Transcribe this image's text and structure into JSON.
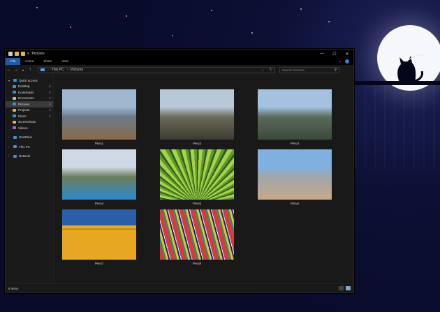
{
  "window": {
    "title": "Pictures",
    "controls": [
      "—",
      "☐",
      "✕"
    ]
  },
  "ribbon": {
    "tabs": [
      "File",
      "Home",
      "Share",
      "View"
    ]
  },
  "address": {
    "path": [
      "This PC",
      "Pictures"
    ],
    "search_placeholder": "Search Pictures"
  },
  "nav": {
    "items": [
      {
        "label": "Quick access",
        "icon": "star-icon",
        "color": "#3d8fe0",
        "level": 0,
        "chev": "▾"
      },
      {
        "label": "Desktop",
        "icon": "desktop-folder-icon",
        "color": "#3d8fe0",
        "level": 1,
        "pin": true
      },
      {
        "label": "Downloads",
        "icon": "downloads-folder-icon",
        "color": "#3d8fe0",
        "level": 1,
        "pin": true
      },
      {
        "label": "Documents",
        "icon": "documents-folder-icon",
        "color": "#bbbbbb",
        "level": 1,
        "pin": true
      },
      {
        "label": "Pictures",
        "icon": "pictures-folder-icon",
        "color": "#3d8fe0",
        "level": 1,
        "pin": true,
        "selected": true
      },
      {
        "label": "Projects",
        "icon": "folder-icon",
        "color": "#e0b84a",
        "level": 1,
        "pin": true
      },
      {
        "label": "Music",
        "icon": "music-icon",
        "color": "#3d8fe0",
        "level": 1,
        "pin": true
      },
      {
        "label": "Screenshots",
        "icon": "folder-icon",
        "color": "#e0b84a",
        "level": 1
      },
      {
        "label": "Videos",
        "icon": "videos-folder-icon",
        "color": "#9b6bd6",
        "level": 1
      },
      {
        "label": "",
        "icon": "",
        "color": "",
        "level": -1
      },
      {
        "label": "OneDrive",
        "icon": "cloud-icon",
        "color": "#3d8fe0",
        "level": 0,
        "chev": "›"
      },
      {
        "label": "",
        "icon": "",
        "color": "",
        "level": -1
      },
      {
        "label": "This PC",
        "icon": "pc-icon",
        "color": "#3d8fe0",
        "level": 0,
        "chev": "›"
      },
      {
        "label": "",
        "icon": "",
        "color": "",
        "level": -1
      },
      {
        "label": "Network",
        "icon": "network-icon",
        "color": "#3d8fe0",
        "level": 0,
        "chev": "›"
      }
    ]
  },
  "photos": [
    {
      "caption": "Peru1",
      "colors": [
        "#9fb7d1",
        "#6b7b8a",
        "#8a6a4a"
      ]
    },
    {
      "caption": "Peru2",
      "colors": [
        "#b9c8d8",
        "#6a6a5a",
        "#3e3a30"
      ]
    },
    {
      "caption": "Peru3",
      "colors": [
        "#a4c2e0",
        "#5a6a5a",
        "#3b4a3a"
      ]
    },
    {
      "caption": "Peru4",
      "colors": [
        "#cfd9e4",
        "#6b7d5a",
        "#2a8ad0"
      ]
    },
    {
      "caption": "Peru5",
      "colors": [
        "#a9d24a",
        "#5e9a2a",
        "#2c5a18"
      ]
    },
    {
      "caption": "Peru6",
      "colors": [
        "#7fb0e0",
        "#a0a6aa",
        "#c8a888"
      ]
    },
    {
      "caption": "Peru7",
      "colors": [
        "#2a5fa8",
        "#e6a820",
        "#c07a10"
      ]
    },
    {
      "caption": "Peru8",
      "colors": [
        "#d83a3a",
        "#3a8a5a",
        "#e0c23a"
      ]
    }
  ],
  "status": {
    "count": "8 items"
  }
}
